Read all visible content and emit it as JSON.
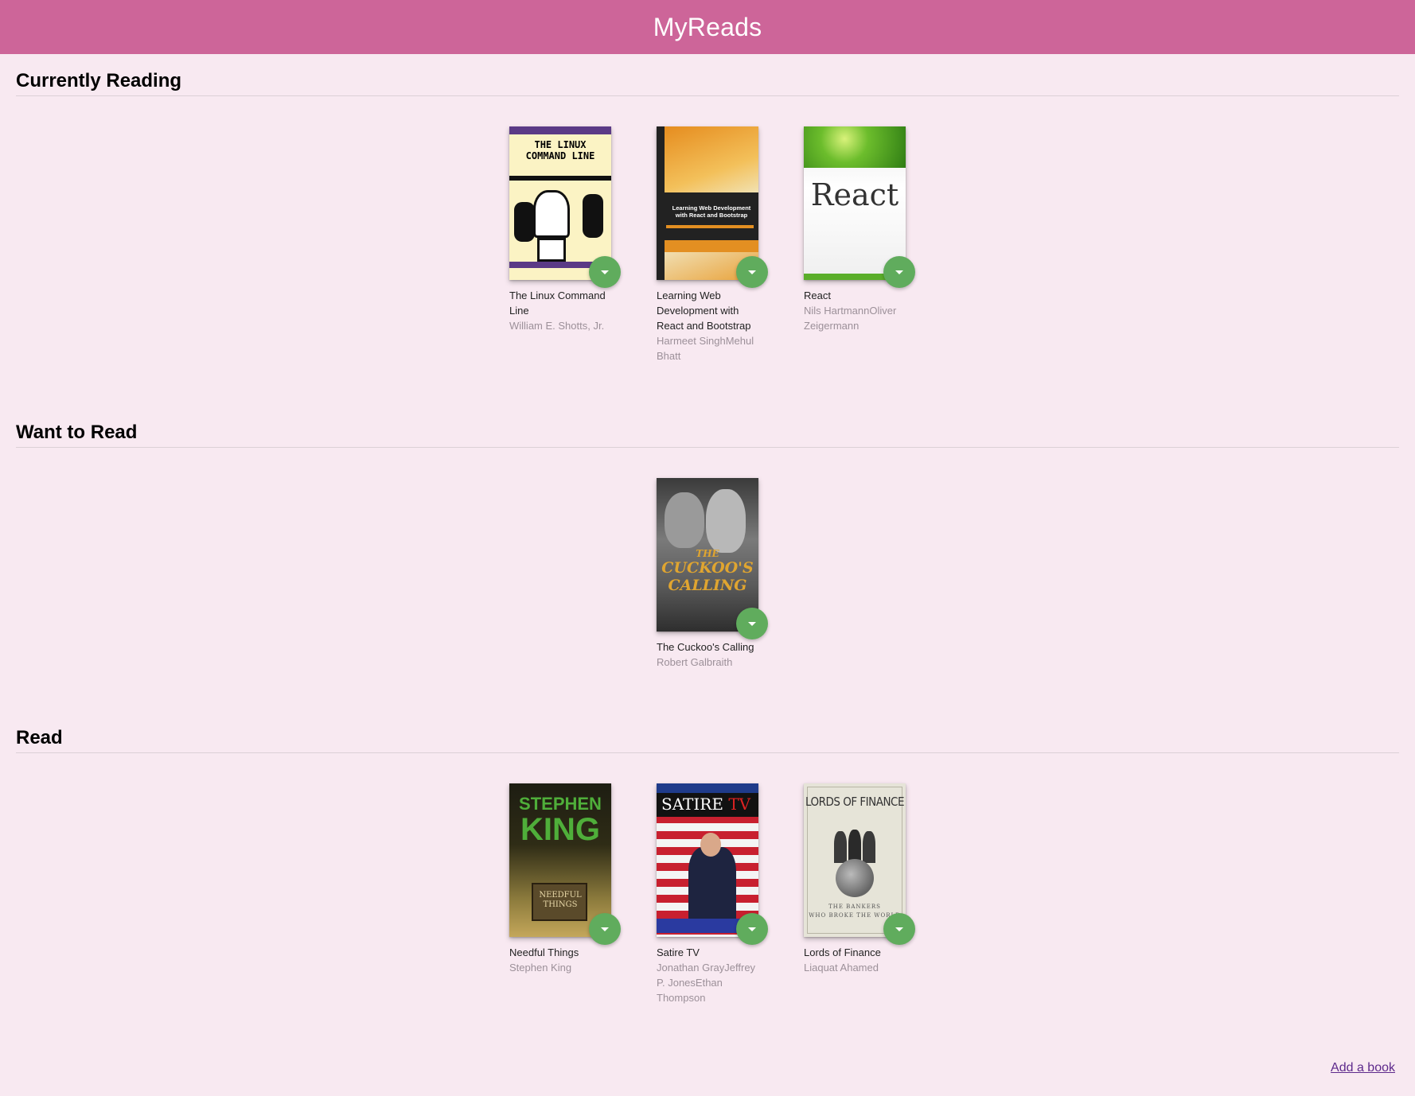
{
  "app": {
    "title": "MyReads"
  },
  "shelves": [
    {
      "title": "Currently Reading",
      "books": [
        {
          "title": "The Linux Command Line",
          "authors": "William E. Shotts, Jr.",
          "cover_text": [
            "THE LINUX",
            "COMMAND LINE"
          ]
        },
        {
          "title": "Learning Web Development with React and Bootstrap",
          "authors": "Harmeet SinghMehul Bhatt",
          "cover_text": [
            "Learning Web Development",
            "with React and Bootstrap"
          ]
        },
        {
          "title": "React",
          "authors": "Nils HartmannOliver Zeigermann",
          "cover_text": [
            "React"
          ]
        }
      ]
    },
    {
      "title": "Want to Read",
      "books": [
        {
          "title": "The Cuckoo's Calling",
          "authors": "Robert Galbraith",
          "cover_text": [
            "THE",
            "CUCKOO'S",
            "CALLING"
          ]
        }
      ]
    },
    {
      "title": "Read",
      "books": [
        {
          "title": "Needful Things",
          "authors": "Stephen King",
          "cover_text": [
            "STEPHEN",
            "KING",
            "NEEDFUL",
            "THINGS"
          ]
        },
        {
          "title": "Satire TV",
          "authors": "Jonathan GrayJeffrey P. JonesEthan Thompson",
          "cover_text": [
            "SATIRE",
            "TV"
          ]
        },
        {
          "title": "Lords of Finance",
          "authors": "Liaquat Ahamed",
          "cover_text": [
            "LORDS OF FINANCE",
            "THE BANKERS",
            "WHO BROKE THE WORLD"
          ]
        }
      ]
    }
  ],
  "actions": {
    "add_book": "Add a book"
  },
  "colors": {
    "header": "#cd6599",
    "background": "#f8e9f1",
    "changer": "#60ac5d",
    "link": "#5e2a8c"
  }
}
